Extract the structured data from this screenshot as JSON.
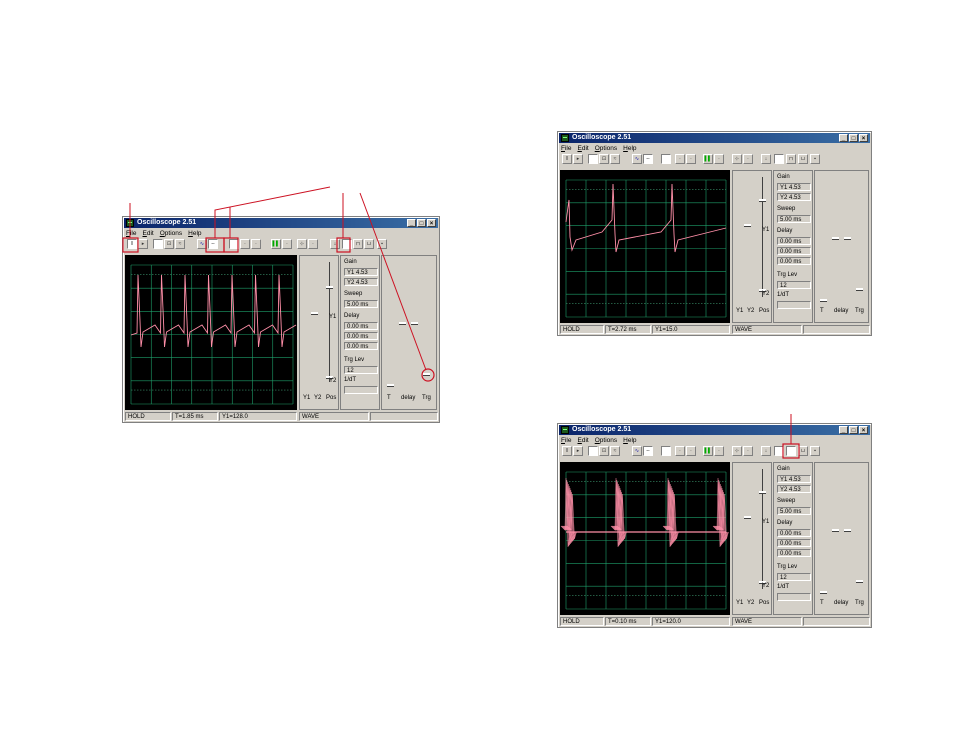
{
  "windows": [
    {
      "id": "main",
      "title": "Oscilloscope 2.51",
      "menu": [
        "File",
        "Edit",
        "Options",
        "Help"
      ],
      "controls": {
        "gain_label": "Gain",
        "y1_value": "Y1  4.53",
        "y2_value": "Y2  4.53",
        "sweep_label": "Sweep",
        "sweep_value": "5.00 ms",
        "delay_label": "Delay",
        "delay_values": [
          "0.00 ms",
          "0.00 ms",
          "0.00 ms"
        ],
        "trg_lev_label": "Trg Lev",
        "trg_lev_value": "12",
        "dt_label": "1/dT",
        "slider_labels": [
          "Y1",
          "Y2",
          "Pos"
        ],
        "y1_marker": "Y1",
        "y2_marker": "Y2",
        "right_slider_labels": [
          "T",
          "delay",
          "Trg"
        ]
      },
      "status": {
        "mode": "HOLD",
        "time": "T=1.85 ms",
        "y1": "Y1=128.0",
        "wave": "WAVE"
      }
    },
    {
      "id": "top-right",
      "title": "Oscilloscope 2.51",
      "menu": [
        "File",
        "Edit",
        "Options",
        "Help"
      ],
      "controls": {
        "gain_label": "Gain",
        "y1_value": "Y1  4.53",
        "y2_value": "Y2  4.53",
        "sweep_label": "Sweep",
        "sweep_value": "5.00 ms",
        "delay_label": "Delay",
        "delay_values": [
          "0.00 ms",
          "0.00 ms",
          "0.00 ms"
        ],
        "trg_lev_label": "Trg Lev",
        "trg_lev_value": "12",
        "dt_label": "1/dT",
        "slider_labels": [
          "Y1",
          "Y2",
          "Pos"
        ],
        "y1_marker": "Y1",
        "y2_marker": "Y2",
        "right_slider_labels": [
          "T",
          "delay",
          "Trg"
        ]
      },
      "status": {
        "mode": "HOLD",
        "time": "T=2.72 ms",
        "y1": "Y1=15.0",
        "wave": "WAVE"
      }
    },
    {
      "id": "bottom-right",
      "title": "Oscilloscope 2.51",
      "menu": [
        "File",
        "Edit",
        "Options",
        "Help"
      ],
      "controls": {
        "gain_label": "Gain",
        "y1_value": "Y1  4.53",
        "y2_value": "Y2  4.53",
        "sweep_label": "Sweep",
        "sweep_value": "5.00 ms",
        "delay_label": "Delay",
        "delay_values": [
          "0.00 ms",
          "0.00 ms",
          "0.00 ms"
        ],
        "trg_lev_label": "Trg Lev",
        "trg_lev_value": "12",
        "dt_label": "1/dT",
        "slider_labels": [
          "Y1",
          "Y2",
          "Pos"
        ],
        "y1_marker": "Y1",
        "y2_marker": "Y2",
        "right_slider_labels": [
          "T",
          "delay",
          "Trg"
        ]
      },
      "status": {
        "mode": "HOLD",
        "time": "T=0.10 ms",
        "y1": "Y1=120.0",
        "wave": "WAVE"
      }
    }
  ],
  "colors": {
    "trace": "#ff8fa8",
    "grid": "#1e9e6a",
    "callout": "#cc1122",
    "titlebar": "#0a246a"
  },
  "icons": {
    "hold": "pause-icon",
    "wave": "wave-icon",
    "bars": "color-bars-icon",
    "trigger": "down-arrow-icon"
  }
}
